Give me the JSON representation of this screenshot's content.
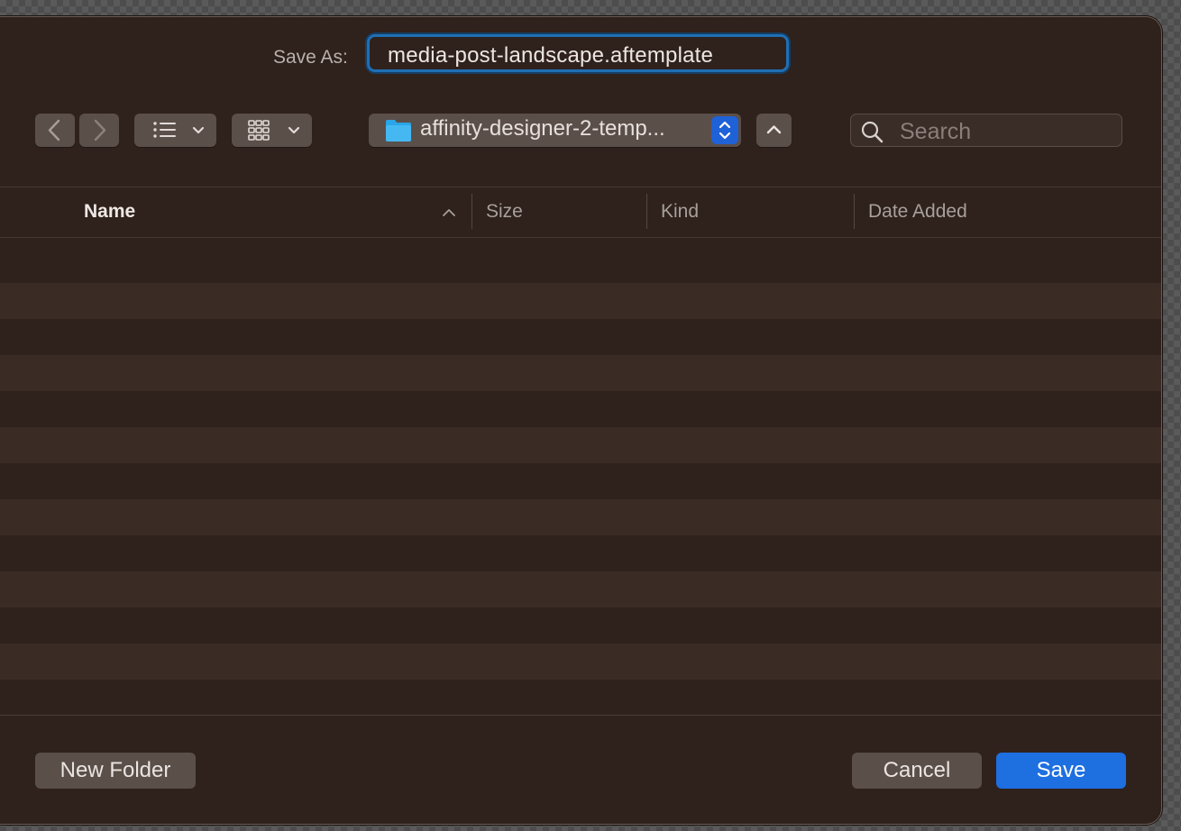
{
  "header": {
    "save_as_label": "Save As:",
    "filename_value": "media-post-landscape.aftemplate"
  },
  "toolbar": {
    "back_icon": "chevron-left-icon",
    "forward_icon": "chevron-right-icon",
    "list_view_icon": "list-view-icon",
    "grid_view_icon": "grid-view-icon",
    "location_label": "affinity-designer-2-temp...",
    "location_icon": "folder-icon",
    "search_placeholder": "Search"
  },
  "columns": {
    "name": "Name",
    "size": "Size",
    "kind": "Kind",
    "date_added": "Date Added"
  },
  "footer": {
    "new_folder_label": "New Folder",
    "cancel_label": "Cancel",
    "save_label": "Save"
  },
  "colors": {
    "accent": "#1e6fe0",
    "background": "#2f211c",
    "focus_ring": "#1f6fb5"
  }
}
